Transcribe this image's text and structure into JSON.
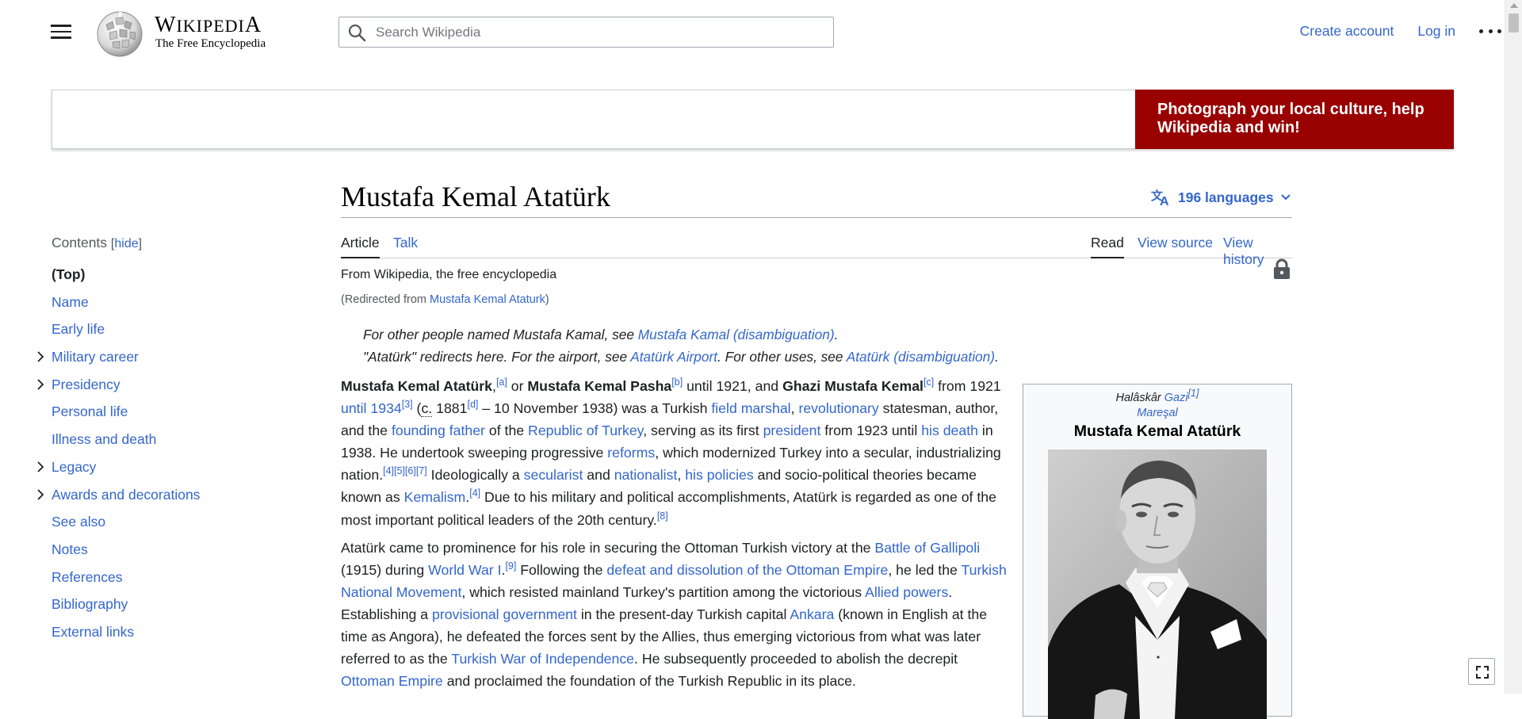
{
  "header": {
    "wordmark": "Wikipedia",
    "tagline": "The Free Encyclopedia",
    "search_placeholder": "Search Wikipedia",
    "create_account": "Create account",
    "log_in": "Log in"
  },
  "banner": {
    "cta": "Photograph your local culture, help Wikipedia and win!",
    "cta_bg": "#990000"
  },
  "toc": {
    "heading": "Contents",
    "hide_label": "hide",
    "items": [
      {
        "label": "(Top)",
        "expandable": false
      },
      {
        "label": "Name",
        "expandable": false
      },
      {
        "label": "Early life",
        "expandable": false
      },
      {
        "label": "Military career",
        "expandable": true
      },
      {
        "label": "Presidency",
        "expandable": true
      },
      {
        "label": "Personal life",
        "expandable": false
      },
      {
        "label": "Illness and death",
        "expandable": false
      },
      {
        "label": "Legacy",
        "expandable": true
      },
      {
        "label": "Awards and decorations",
        "expandable": true
      },
      {
        "label": "See also",
        "expandable": false
      },
      {
        "label": "Notes",
        "expandable": false
      },
      {
        "label": "References",
        "expandable": false
      },
      {
        "label": "Bibliography",
        "expandable": false
      },
      {
        "label": "External links",
        "expandable": false
      }
    ]
  },
  "article": {
    "title": "Mustafa Kemal Atatürk",
    "languages": "196 languages",
    "tabs": {
      "article": "Article",
      "talk": "Talk",
      "read": "Read",
      "view_source": "View source",
      "view_history": "View history"
    },
    "from": "From Wikipedia, the free encyclopedia",
    "redirect_prefix": "(Redirected from ",
    "redirect_link": "Mustafa Kemal Ataturk",
    "redirect_suffix": ")",
    "hatnote1": {
      "pre": "For other people named Mustafa Kamal, see ",
      "link": "Mustafa Kamal (disambiguation)",
      "post": "."
    },
    "hatnote2": {
      "pre": "\"Atatürk\" redirects here. For the airport, see ",
      "link1": "Atatürk Airport",
      "mid": ". For other uses, see ",
      "link2": "Atatürk (disambiguation)",
      "post": "."
    }
  },
  "infobox": {
    "line1_text": "Halâskâr ",
    "line1_link": "Gazi",
    "line1_ref": "[1]",
    "line2": "Mareşal",
    "name": "Mustafa Kemal Atatürk"
  },
  "colors": {
    "link": "#3366cc",
    "text": "#202122"
  }
}
